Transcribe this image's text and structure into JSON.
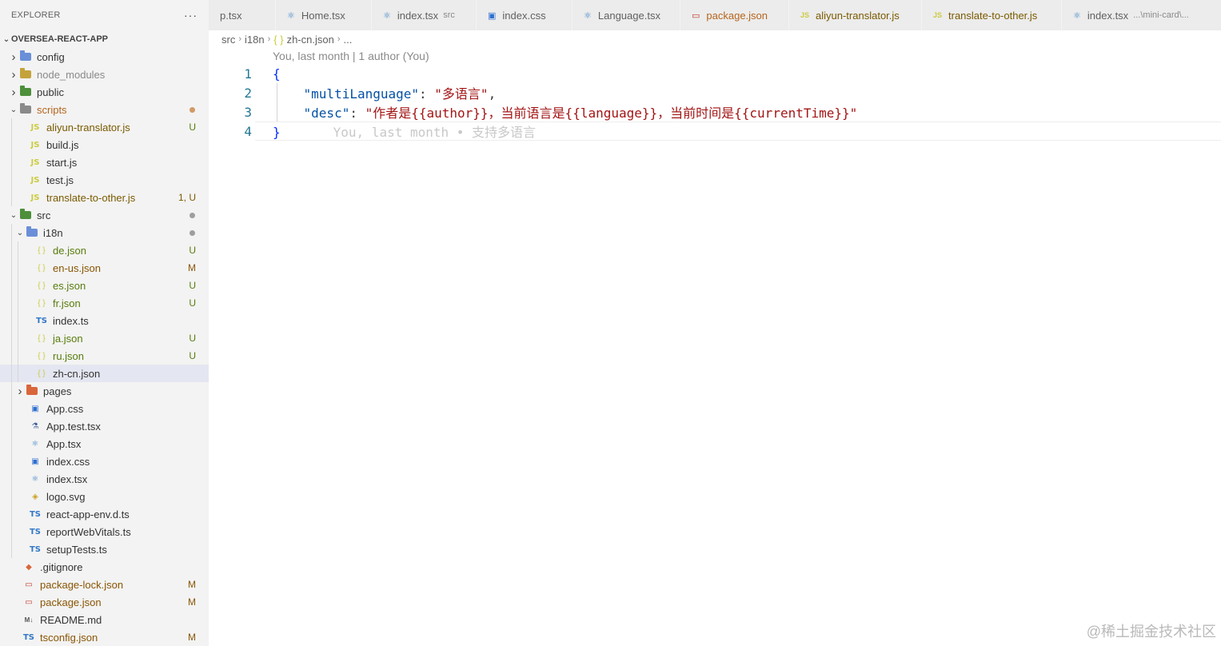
{
  "explorer": {
    "title": "EXPLORER",
    "more": "···",
    "root": "OVERSEA-REACT-APP",
    "items": [
      {
        "label": "config",
        "depth": 1,
        "kind": "folder",
        "open": false,
        "color": "#6a8fd8"
      },
      {
        "label": "node_modules",
        "depth": 1,
        "kind": "folder",
        "open": false,
        "color": "#c4a33c",
        "muted": true
      },
      {
        "label": "public",
        "depth": 1,
        "kind": "folder",
        "open": false,
        "color": "#4d8f3b"
      },
      {
        "label": "scripts",
        "depth": 1,
        "kind": "folder",
        "open": true,
        "color": "#8a8a8a",
        "dot": "#d19a66",
        "labelColor": "#b5651d"
      },
      {
        "label": "aliyun-translator.js",
        "depth": 2,
        "kind": "js",
        "status": "U",
        "labelColor": "#7a5a00"
      },
      {
        "label": "build.js",
        "depth": 2,
        "kind": "js"
      },
      {
        "label": "start.js",
        "depth": 2,
        "kind": "js"
      },
      {
        "label": "test.js",
        "depth": 2,
        "kind": "js"
      },
      {
        "label": "translate-to-other.js",
        "depth": 2,
        "kind": "js",
        "status": "1, U",
        "labelColor": "#7a5a00"
      },
      {
        "label": "src",
        "depth": 1,
        "kind": "folder",
        "open": true,
        "color": "#4d8f3b",
        "dot": "#9e9e9e"
      },
      {
        "label": "i18n",
        "depth": 2,
        "kind": "folder",
        "open": true,
        "color": "#6a8fd8",
        "dot": "#9e9e9e"
      },
      {
        "label": "de.json",
        "depth": 3,
        "kind": "json",
        "status": "U"
      },
      {
        "label": "en-us.json",
        "depth": 3,
        "kind": "json",
        "status": "M"
      },
      {
        "label": "es.json",
        "depth": 3,
        "kind": "json",
        "status": "U"
      },
      {
        "label": "fr.json",
        "depth": 3,
        "kind": "json",
        "status": "U"
      },
      {
        "label": "index.ts",
        "depth": 3,
        "kind": "ts"
      },
      {
        "label": "ja.json",
        "depth": 3,
        "kind": "json",
        "status": "U"
      },
      {
        "label": "ru.json",
        "depth": 3,
        "kind": "json",
        "status": "U"
      },
      {
        "label": "zh-cn.json",
        "depth": 3,
        "kind": "json",
        "selected": true
      },
      {
        "label": "pages",
        "depth": 2,
        "kind": "folder",
        "open": false,
        "color": "#d9663b"
      },
      {
        "label": "App.css",
        "depth": 2,
        "kind": "css"
      },
      {
        "label": "App.test.tsx",
        "depth": 2,
        "kind": "test"
      },
      {
        "label": "App.tsx",
        "depth": 2,
        "kind": "react"
      },
      {
        "label": "index.css",
        "depth": 2,
        "kind": "css"
      },
      {
        "label": "index.tsx",
        "depth": 2,
        "kind": "react"
      },
      {
        "label": "logo.svg",
        "depth": 2,
        "kind": "svg"
      },
      {
        "label": "react-app-env.d.ts",
        "depth": 2,
        "kind": "ts"
      },
      {
        "label": "reportWebVitals.ts",
        "depth": 2,
        "kind": "ts"
      },
      {
        "label": "setupTests.ts",
        "depth": 2,
        "kind": "ts"
      },
      {
        "label": ".gitignore",
        "depth": 1,
        "kind": "git"
      },
      {
        "label": "package-lock.json",
        "depth": 1,
        "kind": "pkg",
        "status": "M"
      },
      {
        "label": "package.json",
        "depth": 1,
        "kind": "pkg",
        "status": "M"
      },
      {
        "label": "README.md",
        "depth": 1,
        "kind": "md"
      },
      {
        "label": "tsconfig.json",
        "depth": 1,
        "kind": "ts",
        "status": "M"
      }
    ]
  },
  "tabs": [
    {
      "label": "p.tsx",
      "kind": "none"
    },
    {
      "label": "Home.tsx",
      "kind": "react"
    },
    {
      "label": "index.tsx",
      "kind": "react",
      "desc": "src"
    },
    {
      "label": "index.css",
      "kind": "css"
    },
    {
      "label": "Language.tsx",
      "kind": "react"
    },
    {
      "label": "package.json",
      "kind": "pkg",
      "labelColor": "#b5651d"
    },
    {
      "label": "aliyun-translator.js",
      "kind": "js",
      "labelColor": "#7a5a00"
    },
    {
      "label": "translate-to-other.js",
      "kind": "js",
      "labelColor": "#7a5a00"
    },
    {
      "label": "index.tsx",
      "kind": "react",
      "desc": "...\\mini-card\\..."
    }
  ],
  "breadcrumb": {
    "parts": [
      "src",
      "i18n",
      "zh-cn.json",
      "..."
    ]
  },
  "editor": {
    "codelens": "You, last month | 1 author (You)",
    "line_numbers": [
      "1",
      "2",
      "3",
      "4"
    ],
    "open_brace": "{",
    "close_brace": "}",
    "key1": "\"multiLanguage\"",
    "val1": "\"多语言\"",
    "key2": "\"desc\"",
    "val2": "\"作者是{{author}}，当前语言是{{language}}，当前时间是{{currentTime}}\"",
    "colon": ": ",
    "comma": ",",
    "blame": "You, last month • 支持多语言"
  },
  "watermark": "@稀土掘金技术社区"
}
